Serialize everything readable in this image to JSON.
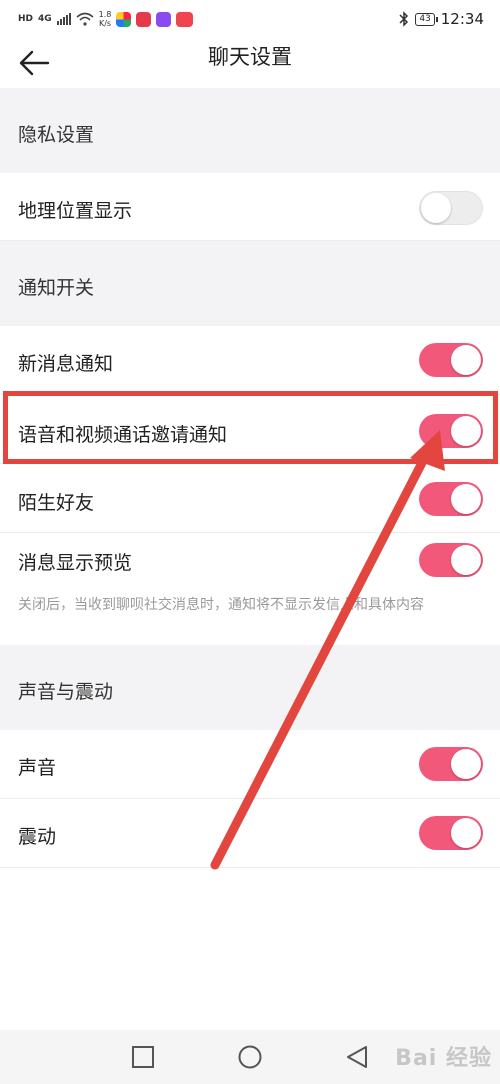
{
  "status_bar": {
    "badge": "HD",
    "network": "4G",
    "speed_value": "1.8",
    "speed_unit": "K/s",
    "battery": "43",
    "time": "12:34",
    "icons": [
      "signal-icon",
      "wifi-icon",
      "app-icon-colorful",
      "app-icon-red",
      "app-icon-purple",
      "app-icon-red2",
      "bluetooth-icon",
      "battery-icon"
    ]
  },
  "header": {
    "title": "聊天设置",
    "back_icon": "back-arrow-icon"
  },
  "sections": {
    "privacy": {
      "label": "隐私设置"
    },
    "notify": {
      "label": "通知开关"
    },
    "sound": {
      "label": "声音与震动"
    }
  },
  "rows": {
    "location": {
      "label": "地理位置显示",
      "toggle": "off"
    },
    "new_message": {
      "label": "新消息通知",
      "toggle": "on"
    },
    "voice_video": {
      "label": "语音和视频通话邀请通知",
      "toggle": "on"
    },
    "stranger": {
      "label": "陌生好友",
      "toggle": "on"
    },
    "preview": {
      "label": "消息显示预览",
      "toggle": "on"
    },
    "sound": {
      "label": "声音",
      "toggle": "on"
    },
    "vibration": {
      "label": "震动",
      "toggle": "on"
    }
  },
  "preview_hint": "关闭后，当收到聊呗社交消息时，通知将不显示发信人和具体内容",
  "colors": {
    "toggle_on": "#f2587a",
    "toggle_off": "#ededed",
    "section_bg": "#f3f3f5",
    "annotation": "#e2463f"
  },
  "navbar": {
    "icons": [
      "square-icon",
      "circle-icon",
      "triangle-back-icon"
    ]
  },
  "watermark": "Bai 经验"
}
